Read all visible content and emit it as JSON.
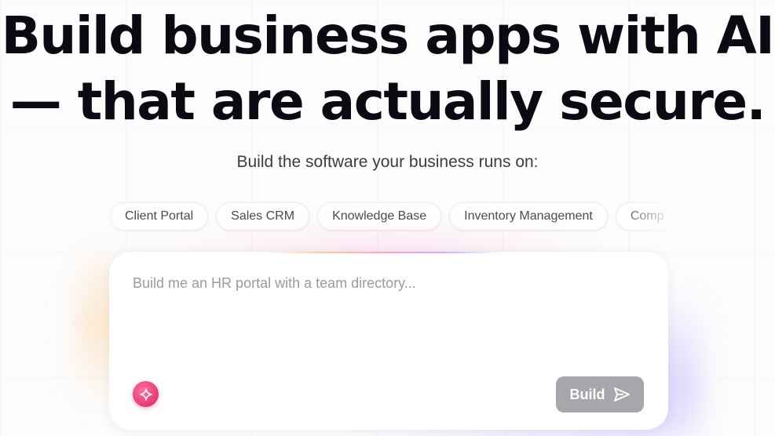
{
  "hero": {
    "headline_line1": "Build business apps with AI",
    "headline_line2": "— that are actually secure.",
    "subtitle": "Build the software your business runs on:"
  },
  "suggestions": [
    {
      "label": "Client Portal"
    },
    {
      "label": "Sales CRM"
    },
    {
      "label": "Knowledge Base"
    },
    {
      "label": "Inventory Management"
    },
    {
      "label": "Comp"
    }
  ],
  "prompt": {
    "placeholder": "Build me an HR portal with a team directory...",
    "value": "",
    "enhance_icon": "sparkle-icon",
    "submit_label": "Build",
    "submit_icon": "send-icon"
  },
  "colors": {
    "accent": "#d9245e",
    "button_disabled": "#a6a6ab",
    "text_primary": "#0a0a12",
    "text_muted": "#9a9aa2"
  }
}
